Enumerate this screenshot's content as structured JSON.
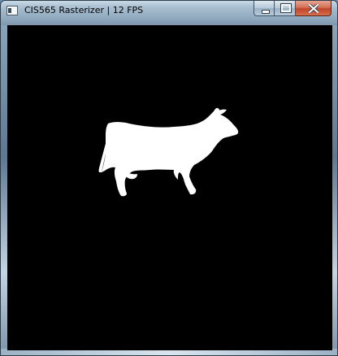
{
  "window": {
    "title": "CIS565 Rasterizer | 12 FPS"
  },
  "caption_buttons": {
    "minimize_icon": "minimize-icon",
    "maximize_icon": "maximize-icon",
    "close_icon": "close-icon"
  },
  "viewport": {
    "background": "#000000",
    "model_color": "#ffffff"
  }
}
